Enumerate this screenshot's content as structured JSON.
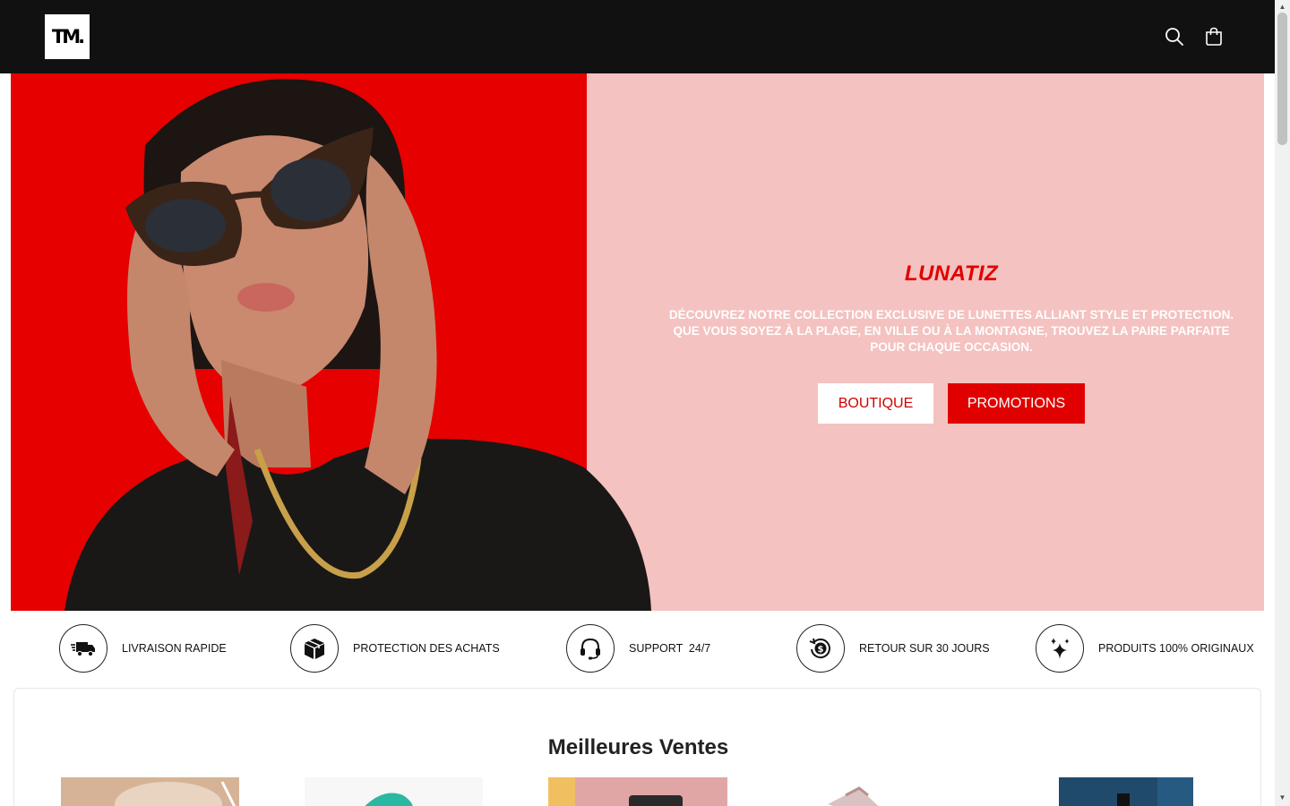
{
  "header": {
    "logo_text": "TM.",
    "icons": [
      "search-icon",
      "cart-icon"
    ],
    "background": "#111111"
  },
  "hero": {
    "title": "LUNATIZ",
    "description": "DÉCOUVREZ NOTRE COLLECTION EXCLUSIVE DE LUNETTES ALLIANT STYLE ET PROTECTION. QUE VOUS SOYEZ À LA PLAGE, EN VILLE OU À LA MONTAGNE, TROUVEZ LA PAIRE PARFAITE POUR CHAQUE OCCASION.",
    "buttons": {
      "shop_label": "BOUTIQUE",
      "promo_label": "PROMOTIONS"
    },
    "colors": {
      "accent": "#e10000",
      "panel": "#f4c2c0",
      "photo_background": "#e60000"
    }
  },
  "features": [
    {
      "icon": "delivery-truck-icon",
      "label": "LIVRAISON RAPIDE"
    },
    {
      "icon": "package-icon",
      "label": "PROTECTION DES ACHATS"
    },
    {
      "icon": "headset-icon",
      "label": "SUPPORT  24/7"
    },
    {
      "icon": "money-back-icon",
      "label": "RETOUR SUR 30 JOURS"
    },
    {
      "icon": "sparkles-icon",
      "label": "PRODUITS 100% ORIGINAUX"
    }
  ],
  "best_sellers": {
    "title": "Meilleures Ventes"
  }
}
